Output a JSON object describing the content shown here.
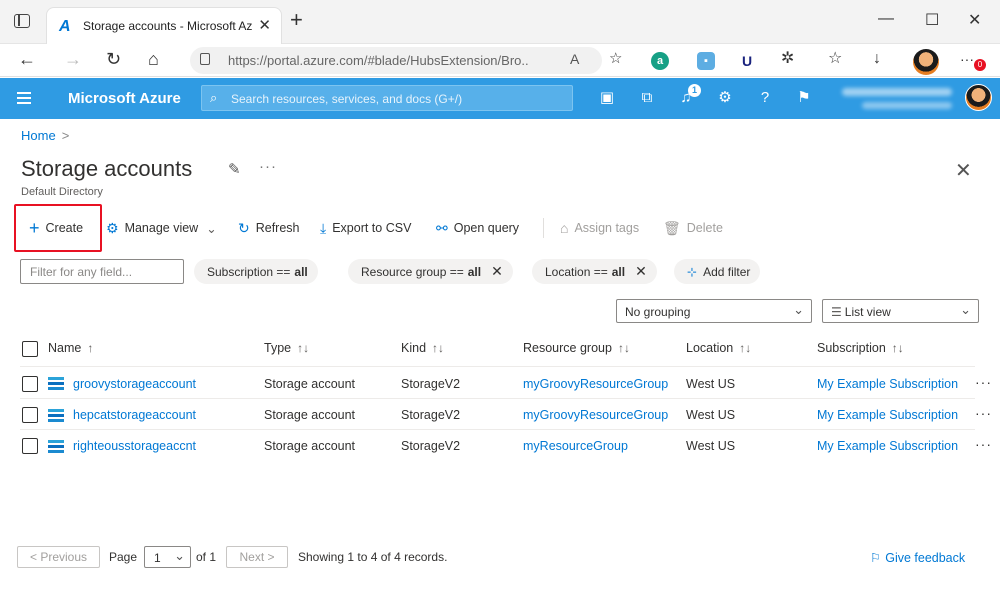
{
  "browser": {
    "tab_title": "Storage accounts - Microsoft Azure",
    "tab_favicon": "A",
    "url": "https://portal.azure.com/#blade/HubsExtension/Bro...",
    "more_badge": "0"
  },
  "header": {
    "brand": "Microsoft Azure",
    "search_placeholder": "Search resources, services, and docs (G+/)",
    "notification_count": "1"
  },
  "breadcrumb": {
    "home": "Home",
    "separator": ">"
  },
  "page": {
    "title": "Storage accounts",
    "subtitle": "Default Directory"
  },
  "toolbar": {
    "create": "Create",
    "manage_view": "Manage view",
    "refresh": "Refresh",
    "export_csv": "Export to CSV",
    "open_query": "Open query",
    "assign_tags": "Assign tags",
    "delete": "Delete"
  },
  "filters": {
    "placeholder": "Filter for any field...",
    "subscription": {
      "label": "Subscription ==",
      "value": "all"
    },
    "resource_group": {
      "label": "Resource group ==",
      "value": "all"
    },
    "location": {
      "label": "Location ==",
      "value": "all"
    },
    "add_filter": "Add filter"
  },
  "view_options": {
    "grouping": "No grouping",
    "view": "List view"
  },
  "table": {
    "columns": [
      "Name",
      "Type",
      "Kind",
      "Resource group",
      "Location",
      "Subscription"
    ],
    "rows": [
      {
        "name": "groovystorageaccount",
        "type": "Storage account",
        "kind": "StorageV2",
        "resource_group": "myGroovyResourceGroup",
        "location": "West US",
        "subscription": "My Example Subscription"
      },
      {
        "name": "hepcatstorageaccount",
        "type": "Storage account",
        "kind": "StorageV2",
        "resource_group": "myGroovyResourceGroup",
        "location": "West US",
        "subscription": "My Example Subscription"
      },
      {
        "name": "righteousstorageaccnt",
        "type": "Storage account",
        "kind": "StorageV2",
        "resource_group": "myResourceGroup",
        "location": "West US",
        "subscription": "My Example Subscription"
      }
    ]
  },
  "pager": {
    "previous": "< Previous",
    "page_label": "Page",
    "page_value": "1",
    "of_label": "of 1",
    "next": "Next >",
    "summary": "Showing 1 to 4 of 4 records."
  },
  "feedback": "Give feedback",
  "colors": {
    "azure_blue": "#0078d4",
    "header_blue": "#2f9be3",
    "highlight_red": "#e81123"
  }
}
